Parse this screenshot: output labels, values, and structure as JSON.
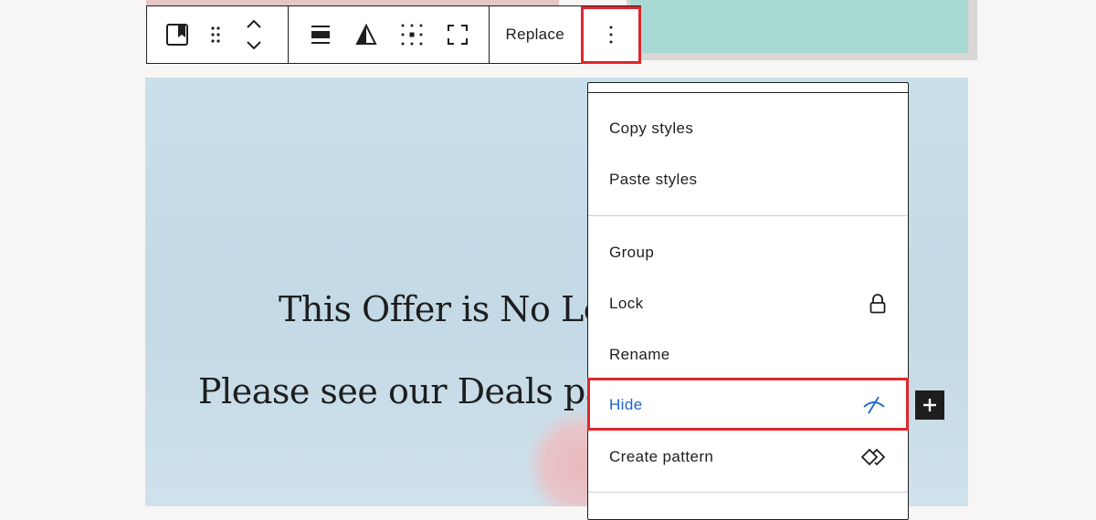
{
  "toolbar": {
    "block_icon": "image-block-icon",
    "drag_icon": "drag-handle-icon",
    "move_icon": "move-up-down-icon",
    "align_icon": "align-icon",
    "duotone_icon": "duotone-filter-icon",
    "position_icon": "content-position-icon",
    "fullheight_icon": "full-height-icon",
    "replace_label": "Replace",
    "options_icon": "more-vertical-icon"
  },
  "hero": {
    "title": "This Offer is No Lon",
    "text": "Please see our Deals page"
  },
  "menu": {
    "items": [
      {
        "label": "Copy styles"
      },
      {
        "label": "Paste styles"
      },
      {
        "label": "Group"
      },
      {
        "label": "Lock",
        "icon": "lock-icon"
      },
      {
        "label": "Rename"
      },
      {
        "label": "Hide",
        "icon": "hide-icon"
      },
      {
        "label": "Create pattern",
        "icon": "pattern-icon"
      }
    ]
  },
  "colors": {
    "highlight": "#e0262b",
    "active": "#1e64c8",
    "hero_bg": "#c9dfeb"
  }
}
